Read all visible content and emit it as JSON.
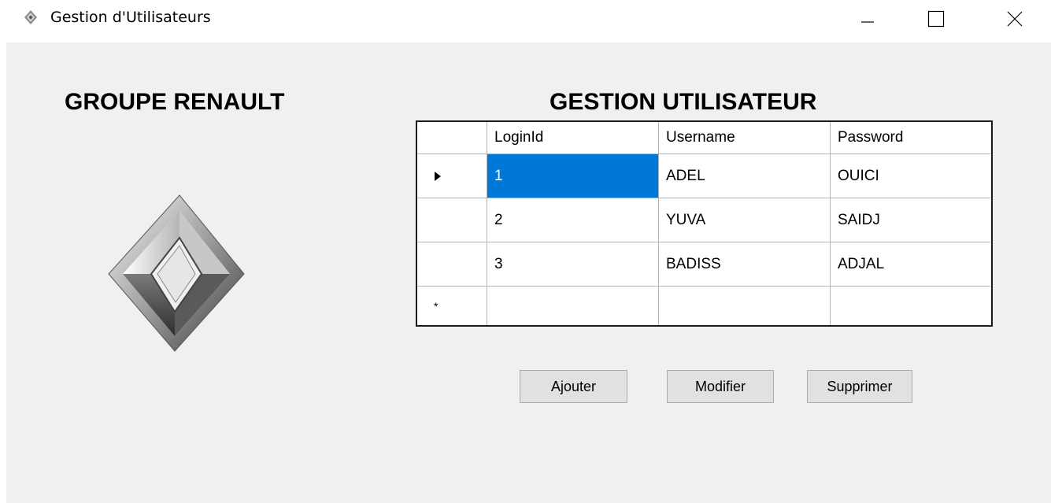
{
  "window": {
    "title": "Gestion d'Utilisateurs",
    "controls": [
      "minimize",
      "maximize",
      "close"
    ]
  },
  "brand": {
    "title": "GROUPE RENAULT",
    "logo_icon": "renault-diamond-logo"
  },
  "page": {
    "title": "GESTION UTILISATEUR"
  },
  "grid": {
    "columns": [
      "LoginId",
      "Username",
      "Password"
    ],
    "rows": [
      {
        "indicator": "current-row-arrow",
        "cells": [
          "1",
          "ADEL",
          "OUICI"
        ],
        "selected_column": 0
      },
      {
        "indicator": "",
        "cells": [
          "2",
          "YUVA",
          "SAIDJ"
        ]
      },
      {
        "indicator": "",
        "cells": [
          "3",
          "BADISS",
          "ADJAL"
        ]
      }
    ],
    "new_row_indicator": "*",
    "selection_color": "#0078d7"
  },
  "buttons": {
    "add": "Ajouter",
    "edit": "Modifier",
    "delete": "Supprimer"
  },
  "colors": {
    "client_background": "#f0f0f0",
    "titlebar_background": "#ffffff"
  }
}
